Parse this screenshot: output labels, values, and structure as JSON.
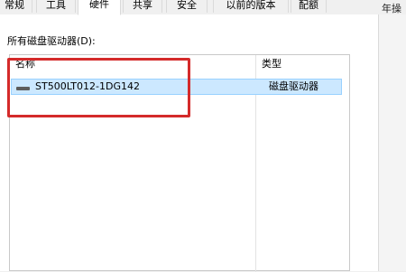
{
  "tabs": [
    {
      "label": "常规",
      "active": false
    },
    {
      "label": "工具",
      "active": false
    },
    {
      "label": "硬件",
      "active": true
    },
    {
      "label": "共享",
      "active": false
    },
    {
      "label": "安全",
      "active": false
    },
    {
      "label": "以前的版本",
      "active": false
    },
    {
      "label": "配额",
      "active": false
    }
  ],
  "side_text": "年操作",
  "group_label": "所有磁盘驱动器(D):",
  "list": {
    "columns": [
      "名称",
      "类型"
    ],
    "rows": [
      {
        "name": "ST500LT012-1DG142",
        "type": "磁盘驱动器",
        "icon": "disk-drive-icon",
        "selected": true
      }
    ]
  },
  "colors": {
    "highlight": "#d42a2a",
    "selection": "#cce8ff",
    "selection_border": "#99d1ff"
  }
}
